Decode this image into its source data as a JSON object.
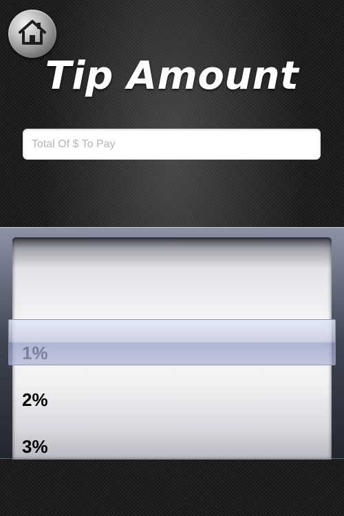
{
  "header": {
    "home_icon": "house-icon",
    "title": "Tip Amount"
  },
  "amount_input": {
    "placeholder": "Total Of $ To Pay",
    "value": ""
  },
  "tip_picker": {
    "options": [
      "1%",
      "2%",
      "3%"
    ],
    "selected": "1%"
  }
}
